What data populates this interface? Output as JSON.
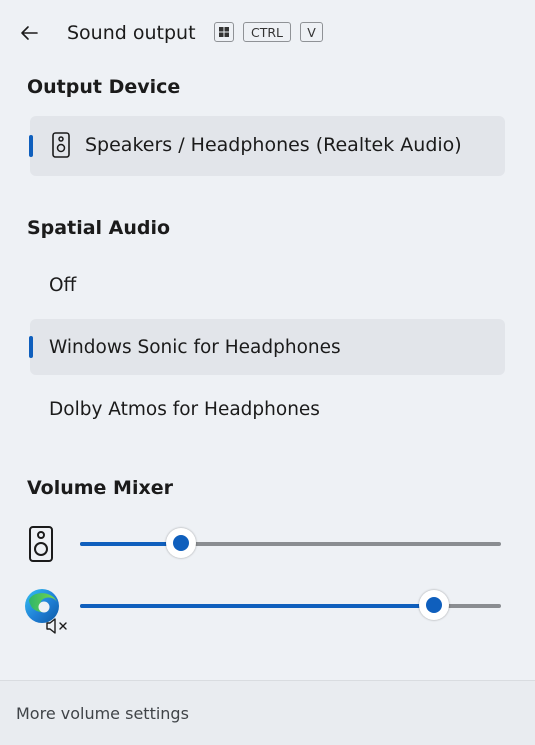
{
  "header": {
    "back_icon": "back-arrow-icon",
    "title": "Sound output",
    "shortcut": {
      "win_key_icon": "windows-key-icon",
      "ctrl": "CTRL",
      "v": "V"
    }
  },
  "output_device": {
    "heading": "Output Device",
    "selected": {
      "label": "Speakers / Headphones (Realtek Audio)",
      "icon": "speaker-icon"
    }
  },
  "spatial_audio": {
    "heading": "Spatial Audio",
    "options": [
      {
        "label": "Off",
        "selected": false
      },
      {
        "label": "Windows Sonic for Headphones",
        "selected": true
      },
      {
        "label": "Dolby Atmos for Headphones",
        "selected": false
      }
    ]
  },
  "volume_mixer": {
    "heading": "Volume Mixer",
    "items": [
      {
        "icon": "speaker-icon",
        "level_fraction": 0.24,
        "muted": false
      },
      {
        "icon": "edge-browser-icon",
        "level_fraction": 0.84,
        "muted": true,
        "mute_icon": "muted-speaker-icon"
      }
    ]
  },
  "footer": {
    "link": "More volume settings"
  },
  "colors": {
    "accent": "#0f5fbd",
    "background": "#eef1f5",
    "selected_bg": "#e2e5ea"
  }
}
